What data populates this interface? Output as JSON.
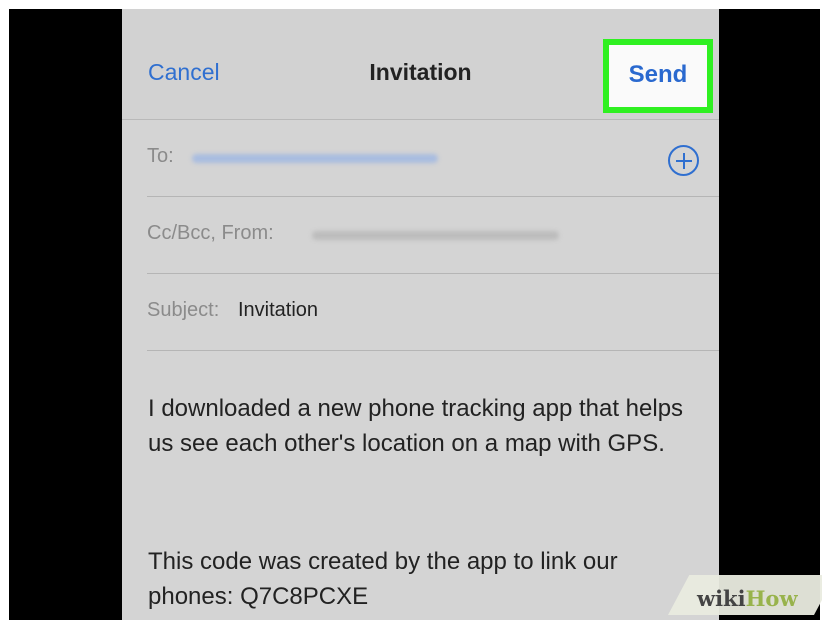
{
  "nav": {
    "cancel_label": "Cancel",
    "title": "Invitation",
    "send_label": "Send"
  },
  "fields": {
    "to_label": "To:",
    "ccbcc_label": "Cc/Bcc, From:",
    "subject_label": "Subject:",
    "subject_value": "Invitation"
  },
  "message": {
    "paragraph1": "I downloaded a new phone tracking app that helps us see each other's location on a map with GPS.",
    "paragraph2": "This code was created by the app to link our phones: Q7C8PCXE"
  },
  "watermark": {
    "wiki": "wiki",
    "how": "How"
  },
  "colors": {
    "accent_blue": "#2f6fd0",
    "highlight_green": "#2ff021",
    "background_gray": "#d4d4d4"
  },
  "icons": {
    "add_recipient": "plus-circle-icon"
  }
}
